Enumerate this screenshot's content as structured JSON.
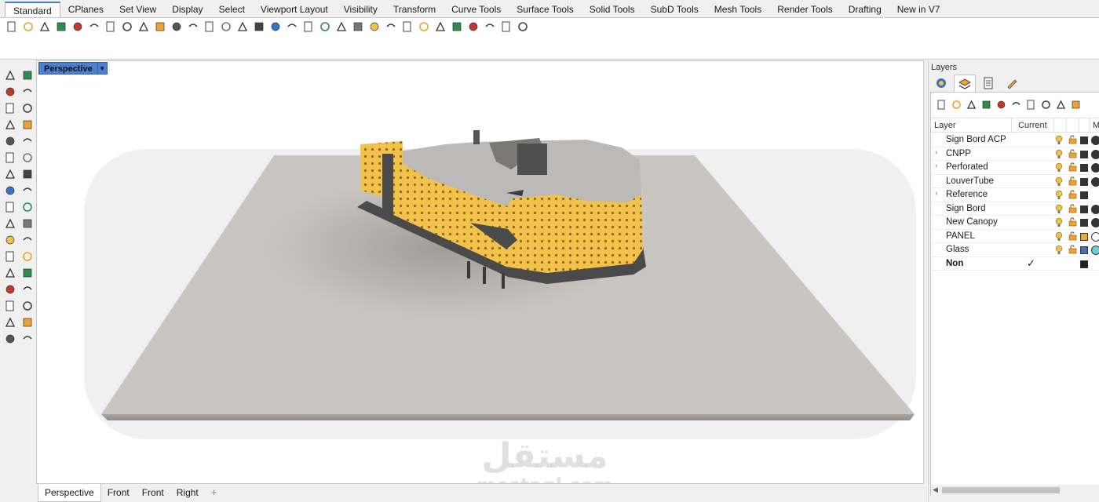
{
  "menu_tabs": [
    "Standard",
    "CPlanes",
    "Set View",
    "Display",
    "Select",
    "Viewport Layout",
    "Visibility",
    "Transform",
    "Curve Tools",
    "Surface Tools",
    "Solid Tools",
    "SubD Tools",
    "Mesh Tools",
    "Render Tools",
    "Drafting",
    "New in V7"
  ],
  "toolbar_icons": [
    "new-icon",
    "open-icon",
    "save-icon",
    "print-icon",
    "import-icon",
    "cut-icon",
    "copy-icon",
    "paste-icon",
    "undo-icon",
    "pan-icon",
    "move-view-icon",
    "zoom-icon",
    "zoom-window-icon",
    "zoom-extents-icon",
    "zoom-selected-icon",
    "rotate-view-icon",
    "four-viewports-icon",
    "cplane-icon",
    "ortho-icon",
    "osnap-icon",
    "select-icon",
    "light-icon",
    "lock-icon",
    "layer-icon",
    "material-icon",
    "wireframe-icon",
    "shaded-icon",
    "render-icon",
    "properties-icon",
    "filter-icon",
    "grasshopper-icon",
    "help-icon"
  ],
  "left_icons": [
    "select-arrow-icon",
    "point-icon",
    "polyline-icon",
    "curve-icon",
    "circle-icon",
    "ellipse-icon",
    "polygon-icon",
    "rectangle-icon",
    "arc-icon",
    "fillet-icon",
    "offset-icon",
    "extend-icon",
    "surface-icon",
    "loft-icon",
    "box-icon",
    "sphere-icon",
    "cylinder-icon",
    "extrude-icon",
    "mesh-icon",
    "split-icon",
    "transform-icon",
    "dimension-icon",
    "boolean-icon",
    "edit-points-icon",
    "join-icon",
    "explode-icon",
    "text-icon",
    "hatch-icon",
    "array-icon",
    "group-icon",
    "analyze-icon",
    "check-icon",
    "render-mesh-icon",
    "block-icon"
  ],
  "viewport": {
    "title": "Perspective",
    "watermark_arabic": "مستقل",
    "watermark_latin": "mostaql.com"
  },
  "viewport_tabs": [
    "Perspective",
    "Front",
    "Front",
    "Right"
  ],
  "viewport_tab_add": "+",
  "layers_panel": {
    "title": "Layers",
    "tabs": [
      "properties-icon",
      "layers-icon",
      "document-icon",
      "render-tools-icon"
    ],
    "column_layer": "Layer",
    "column_current": "Current",
    "column_material": "M",
    "rows": [
      {
        "name": "Sign Bord ACP",
        "expand": "",
        "current": "",
        "color": "#333333",
        "material": "#333333"
      },
      {
        "name": "CNPP",
        "expand": "›",
        "current": "",
        "color": "#333333",
        "material": "#333333"
      },
      {
        "name": "Perforated",
        "expand": "›",
        "current": "",
        "color": "#333333",
        "material": "#333333"
      },
      {
        "name": "LouverTube",
        "expand": "",
        "current": "",
        "color": "#333333",
        "material": "#333333"
      },
      {
        "name": "Reference",
        "expand": "›",
        "current": "",
        "color": "#333333",
        "material": ""
      },
      {
        "name": "Sign Bord",
        "expand": "",
        "current": "",
        "color": "#333333",
        "material": "#333333"
      },
      {
        "name": "New Canopy",
        "expand": "",
        "current": "",
        "color": "#333333",
        "material": "#333333"
      },
      {
        "name": "PANEL",
        "expand": "",
        "current": "",
        "color": "#f0a830",
        "material": "#ffffff"
      },
      {
        "name": "Glass",
        "expand": "",
        "current": "",
        "color": "#4a6fb5",
        "material": "#6ad0d8"
      },
      {
        "name": "Non",
        "expand": "",
        "current": "✓",
        "color": "#222222",
        "material": "",
        "bold": true
      }
    ]
  },
  "colors": {
    "accent": "#4d7fd2",
    "ground": "#c9c6c2",
    "facade": "#f2c24a",
    "roof": "#bcbab8"
  }
}
